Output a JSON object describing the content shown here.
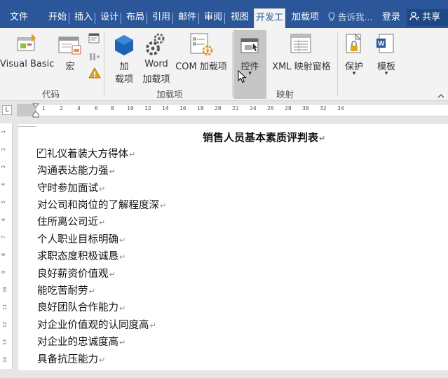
{
  "tabs": {
    "file": "文件",
    "home": "开始",
    "insert": "插入",
    "design": "设计",
    "layout": "布局",
    "references": "引用",
    "mailings": "邮件",
    "review": "审阅",
    "view": "视图",
    "developer": "开发工",
    "addins": "加载项"
  },
  "tell_me": "告诉我",
  "login": "登录",
  "share": "共享",
  "ribbon": {
    "visual_basic": "Visual Basic",
    "macros": "宏",
    "addins_line1": "加",
    "addins_line2": "载项",
    "word_addins_line1": "Word",
    "word_addins_line2": "加载项",
    "com_addins": "COM 加载项",
    "controls": "控件",
    "xml_mapping": "XML 映射窗格",
    "protect": "保护",
    "templates": "模板",
    "groups": {
      "code": "代码",
      "addins": "加载项",
      "mapping": "映射"
    }
  },
  "ruler": {
    "tab_selector": "L",
    "ticks": [
      "1",
      "2",
      "4",
      "6",
      "8",
      "10",
      "12",
      "14",
      "16",
      "18",
      "20",
      "22",
      "24",
      "26",
      "28",
      "30",
      "32",
      "34"
    ],
    "vticks": [
      "1",
      "2",
      "3",
      "4",
      "5",
      "6",
      "7",
      "8",
      "9",
      "10",
      "11",
      "12",
      "13",
      "14"
    ]
  },
  "document": {
    "title": "销售人员基本素质评判表",
    "lines": [
      "礼仪着装大方得体",
      "沟通表达能力强",
      "守时参加面试",
      "对公司和岗位的了解程度深",
      "住所离公司近",
      "个人职业目标明确",
      "求职态度积极诚恳",
      "良好薪资价值观",
      "能吃苦耐劳",
      "良好团队合作能力",
      "对企业价值观的认同度高",
      "对企业的忠诚度高",
      "具备抗压能力"
    ]
  },
  "colors": {
    "tab_bar": "#2b579a",
    "ribbon": "#f3f3f3",
    "selected_button": "#c6c6c6"
  }
}
